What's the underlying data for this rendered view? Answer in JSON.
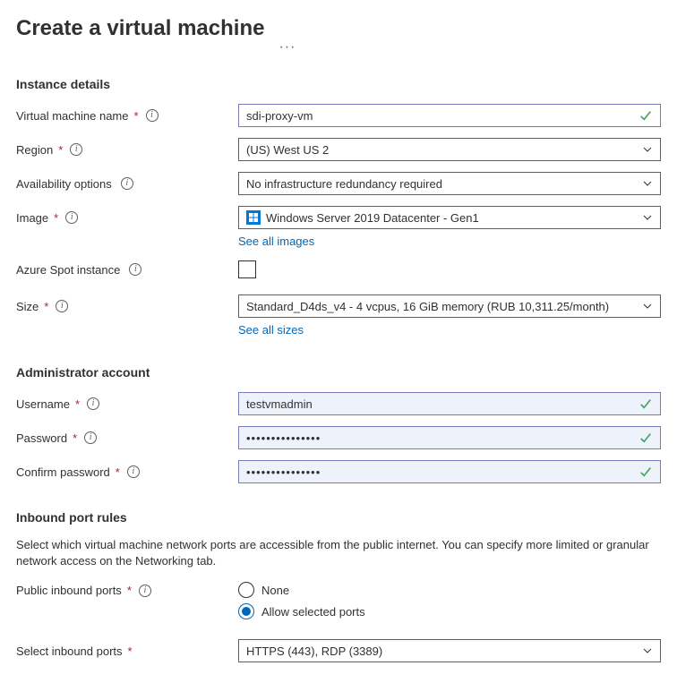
{
  "page": {
    "title": "Create a virtual machine"
  },
  "instance": {
    "section_title": "Instance details",
    "vm_name": {
      "label": "Virtual machine name",
      "value": "sdi-proxy-vm"
    },
    "region": {
      "label": "Region",
      "value": "(US) West US 2"
    },
    "availability": {
      "label": "Availability options",
      "value": "No infrastructure redundancy required"
    },
    "image": {
      "label": "Image",
      "value": "Windows Server 2019 Datacenter - Gen1",
      "link": "See all images"
    },
    "spot": {
      "label": "Azure Spot instance"
    },
    "size": {
      "label": "Size",
      "value": "Standard_D4ds_v4 - 4 vcpus, 16 GiB memory (RUB 10,311.25/month)",
      "link": "See all sizes"
    }
  },
  "admin": {
    "section_title": "Administrator account",
    "username": {
      "label": "Username",
      "value": "testvmadmin"
    },
    "password": {
      "label": "Password",
      "value": "•••••••••••••••"
    },
    "confirm": {
      "label": "Confirm password",
      "value": "•••••••••••••••"
    }
  },
  "ports": {
    "section_title": "Inbound port rules",
    "description": "Select which virtual machine network ports are accessible from the public internet. You can specify more limited or granular network access on the Networking tab.",
    "public_inbound": {
      "label": "Public inbound ports",
      "options": {
        "none": "None",
        "allow": "Allow selected ports"
      },
      "selected": "allow"
    },
    "select_inbound": {
      "label": "Select inbound ports",
      "value": "HTTPS (443), RDP (3389)"
    }
  }
}
